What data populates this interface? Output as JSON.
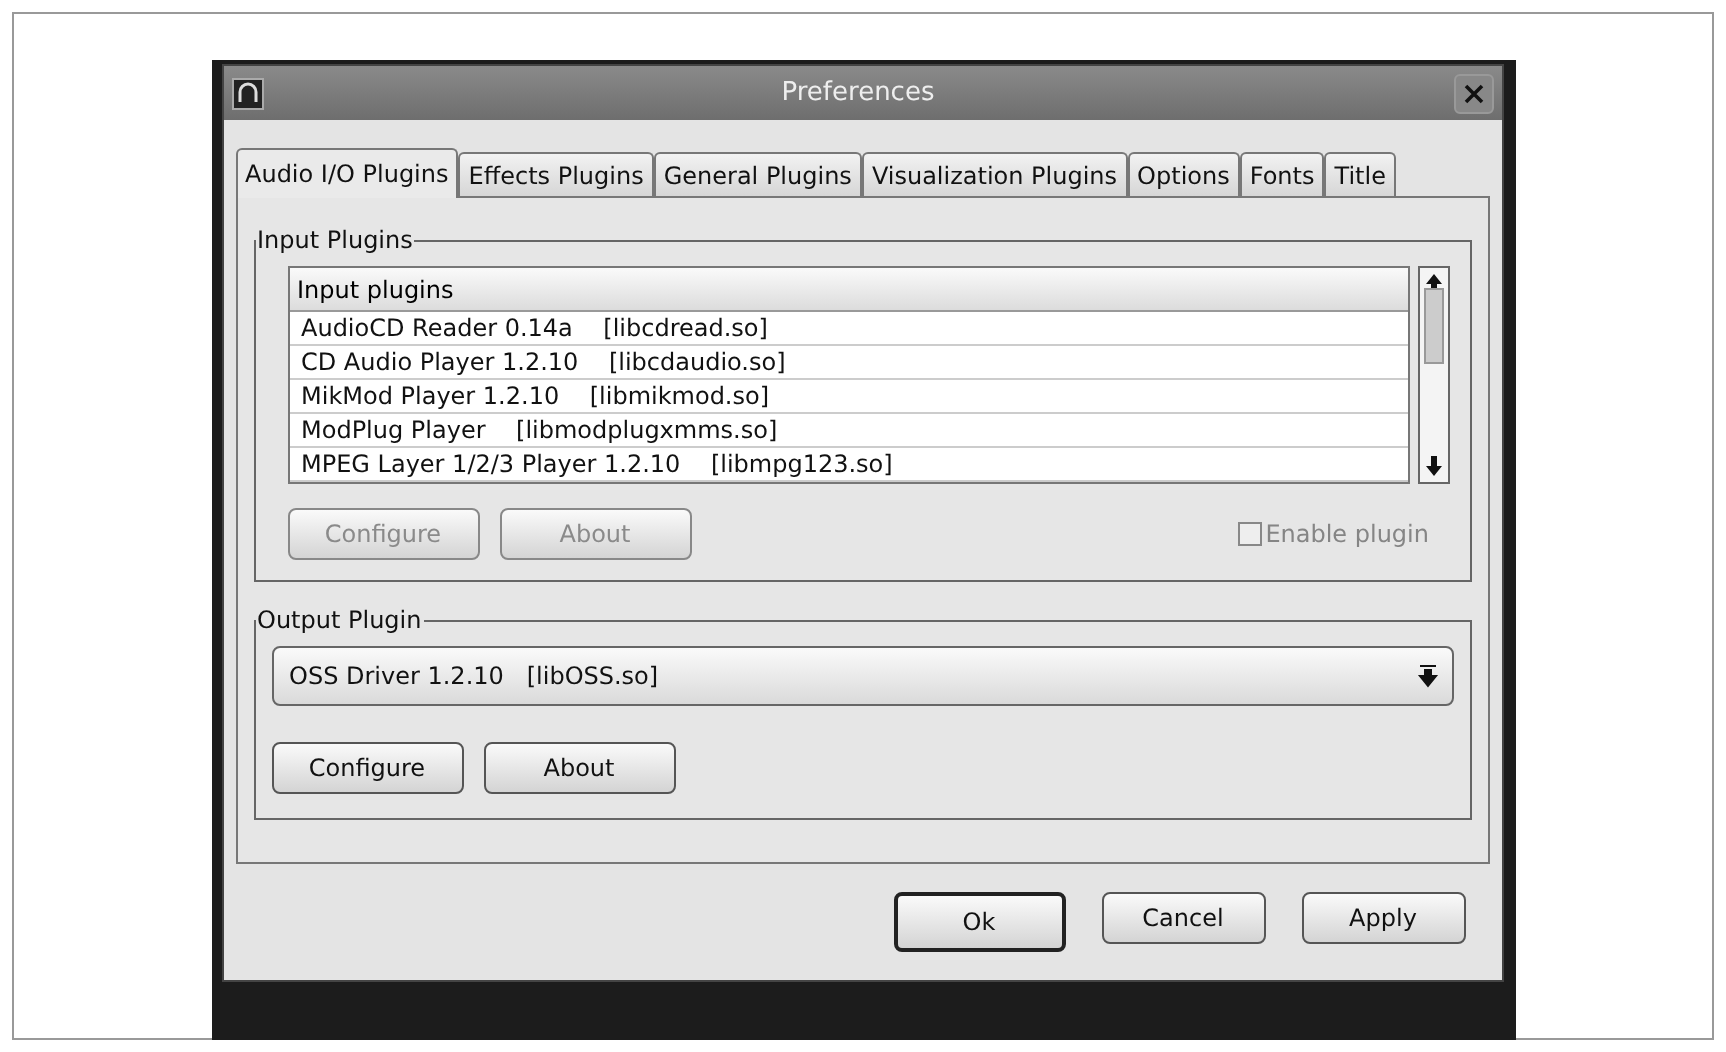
{
  "window": {
    "title": "Preferences"
  },
  "tabs": [
    {
      "label": "Audio I/O Plugins",
      "selected": true
    },
    {
      "label": "Effects Plugins",
      "selected": false
    },
    {
      "label": "General Plugins",
      "selected": false
    },
    {
      "label": "Visualization Plugins",
      "selected": false
    },
    {
      "label": "Options",
      "selected": false
    },
    {
      "label": "Fonts",
      "selected": false
    },
    {
      "label": "Title",
      "selected": false
    }
  ],
  "input_plugins": {
    "title": "Input Plugins",
    "list_header": "Input plugins",
    "items": [
      {
        "name": "AudioCD Reader 0.14a",
        "file": "[libcdread.so]"
      },
      {
        "name": "CD Audio Player 1.2.10",
        "file": "[libcdaudio.so]"
      },
      {
        "name": "MikMod Player 1.2.10",
        "file": "[libmikmod.so]"
      },
      {
        "name": "ModPlug Player",
        "file": "[libmodplugxmms.so]"
      },
      {
        "name": "MPEG Layer 1/2/3 Player 1.2.10",
        "file": "[libmpg123.so]"
      }
    ],
    "buttons": [
      {
        "label": "Configure",
        "disabled": true
      },
      {
        "label": "About",
        "disabled": true
      }
    ],
    "enable_plugin": {
      "label": "Enable plugin",
      "checked": false,
      "disabled": true
    }
  },
  "output_plugin": {
    "title": "Output Plugin",
    "value": "OSS Driver 1.2.10   [libOSS.so]",
    "buttons": [
      {
        "label": "Configure",
        "disabled": false
      },
      {
        "label": "About",
        "disabled": false
      }
    ]
  },
  "dialog_buttons": [
    {
      "label": "Ok",
      "default": true
    },
    {
      "label": "Cancel",
      "default": false
    },
    {
      "label": "Apply",
      "default": false
    }
  ]
}
